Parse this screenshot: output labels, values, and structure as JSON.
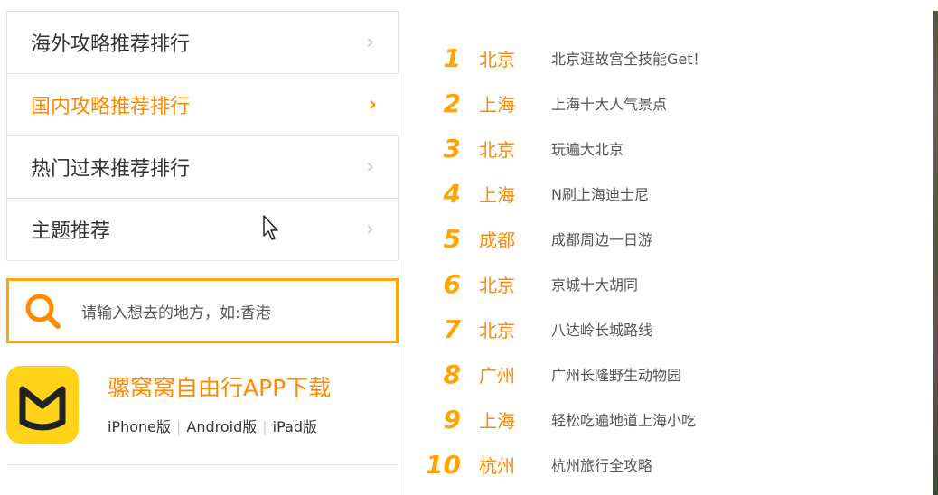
{
  "menu": {
    "items": [
      {
        "label": "海外攻略推荐排行",
        "active": false
      },
      {
        "label": "国内攻略推荐排行",
        "active": true
      },
      {
        "label": "热门过来推荐排行",
        "active": false
      },
      {
        "label": "主题推荐",
        "active": false
      }
    ],
    "chevron": "›"
  },
  "search": {
    "placeholder": "请输入想去的地方，如:香港",
    "icon": "search-icon"
  },
  "app": {
    "title": "骡窝窝自由行APP下载",
    "links": [
      "iPhone版",
      "Android版",
      "iPad版"
    ],
    "separator": "|",
    "logo_icon": "mafengwo-logo-icon"
  },
  "ranking": {
    "items": [
      {
        "rank": "1",
        "city": "北京",
        "title": "北京逛故宫全技能Get！"
      },
      {
        "rank": "2",
        "city": "上海",
        "title": "上海十大人气景点"
      },
      {
        "rank": "3",
        "city": "北京",
        "title": "玩遍大北京"
      },
      {
        "rank": "4",
        "city": "上海",
        "title": "N刷上海迪士尼"
      },
      {
        "rank": "5",
        "city": "成都",
        "title": "成都周边一日游"
      },
      {
        "rank": "6",
        "city": "北京",
        "title": "京城十大胡同"
      },
      {
        "rank": "7",
        "city": "北京",
        "title": "八达岭长城路线"
      },
      {
        "rank": "8",
        "city": "广州",
        "title": "广州长隆野生动物园"
      },
      {
        "rank": "9",
        "city": "上海",
        "title": "轻松吃遍地道上海小吃"
      },
      {
        "rank": "10",
        "city": "杭州",
        "title": "杭州旅行全攻略"
      }
    ]
  },
  "colors": {
    "accent": "#ff8a00",
    "rank_number": "#ffa400",
    "search_border": "#ffa400",
    "logo_bg": "#ffd31a"
  }
}
